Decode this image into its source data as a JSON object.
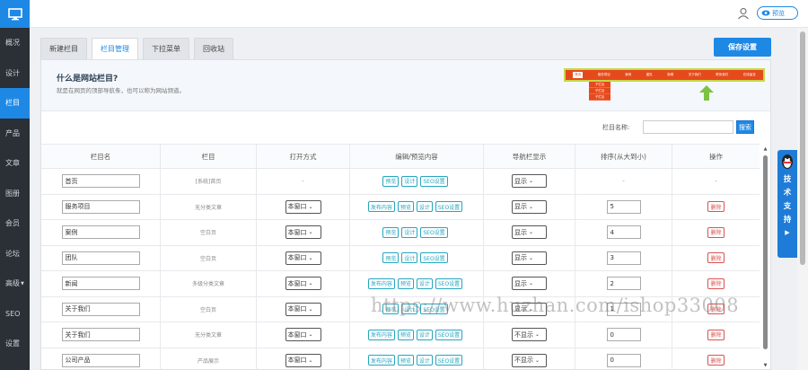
{
  "sidebar": {
    "items": [
      {
        "label": "概况"
      },
      {
        "label": "设计"
      },
      {
        "label": "栏目",
        "active": true
      },
      {
        "label": "产品"
      },
      {
        "label": "文章"
      },
      {
        "label": "图册"
      },
      {
        "label": "会员"
      },
      {
        "label": "论坛"
      },
      {
        "label": "高级"
      },
      {
        "label": "SEO"
      },
      {
        "label": "设置"
      }
    ]
  },
  "topbar": {
    "preview_label": "预览"
  },
  "tabs": [
    {
      "label": "新建栏目"
    },
    {
      "label": "栏目管理",
      "active": true
    },
    {
      "label": "下拉菜单"
    },
    {
      "label": "回收站"
    }
  ],
  "save_label": "保存设置",
  "info": {
    "title": "什么是网站栏目?",
    "desc": "就是在网页的顶部导航条，也可以称为网站频道。",
    "demo_nav": [
      "首页",
      "服务项目",
      "案例",
      "团队",
      "新闻",
      "关于我们",
      "联系我们",
      "在线留言"
    ],
    "demo_sub": [
      "子栏目",
      "子栏目",
      "子栏目"
    ]
  },
  "search": {
    "label": "栏目名称:",
    "value": "",
    "button": "搜索"
  },
  "table": {
    "headers": [
      "栏目名",
      "栏目",
      "打开方式",
      "编辑/预览内容",
      "导航栏显示",
      "排序(从大到小)",
      "操作"
    ],
    "buttons": {
      "publish": "发布内容",
      "preview": "预览",
      "design": "设计",
      "seo": "SEO设置",
      "delete": "删除"
    },
    "dash": "-",
    "rows": [
      {
        "name": "首页",
        "type": "[系统]首页",
        "open": "",
        "publish": false,
        "nav": "显示",
        "order": "",
        "deletable": false
      },
      {
        "name": "服务项目",
        "type": "无分类文章",
        "open": "本窗口",
        "publish": true,
        "nav": "显示",
        "order": "5",
        "deletable": true
      },
      {
        "name": "案例",
        "type": "空白页",
        "open": "本窗口",
        "publish": false,
        "nav": "显示",
        "order": "4",
        "deletable": true
      },
      {
        "name": "团队",
        "type": "空白页",
        "open": "本窗口",
        "publish": false,
        "nav": "显示",
        "order": "3",
        "deletable": true
      },
      {
        "name": "新闻",
        "type": "多级分类文章",
        "open": "本窗口",
        "publish": true,
        "nav": "显示",
        "order": "2",
        "deletable": true
      },
      {
        "name": "关于我们",
        "type": "空白页",
        "open": "本窗口",
        "publish": false,
        "nav": "显示",
        "order": "1",
        "deletable": true
      },
      {
        "name": "关于我们",
        "type": "无分类文章",
        "open": "本窗口",
        "publish": true,
        "nav": "不显示",
        "order": "0",
        "deletable": true
      },
      {
        "name": "公司产品",
        "type": "产品展示",
        "open": "本窗口",
        "publish": true,
        "nav": "不显示",
        "order": "0",
        "deletable": true
      }
    ]
  },
  "support": {
    "label": "技术支持"
  },
  "watermark": "https://www.huzhan.com/ishop33008",
  "colors": {
    "accent": "#1e88e5",
    "sidebar": "#2b2f36",
    "danger": "#d9534f",
    "teal": "#26a6bf"
  }
}
